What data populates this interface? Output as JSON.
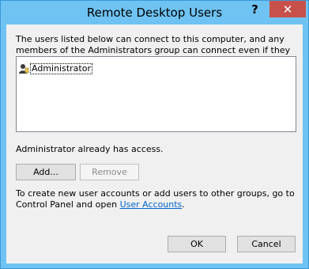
{
  "window": {
    "title": "Remote Desktop Users",
    "help_label": "?",
    "close_label": "✕"
  },
  "intro_text": "The users listed below can connect to this computer, and any members of the Administrators group can connect even if they are not listed.",
  "users": [
    {
      "name": "Administrator",
      "icon": "user-icon"
    }
  ],
  "access_status": "Administrator already has access.",
  "buttons": {
    "add": "Add...",
    "remove": "Remove",
    "ok": "OK",
    "cancel": "Cancel"
  },
  "info": {
    "text": "To create new user accounts or add users to other groups, go to Control Panel and open",
    "link": "User Accounts",
    "suffix": "."
  },
  "colors": {
    "title_bar": "#6fc3f2",
    "close_button": "#c7504a",
    "link": "#0066cc"
  }
}
